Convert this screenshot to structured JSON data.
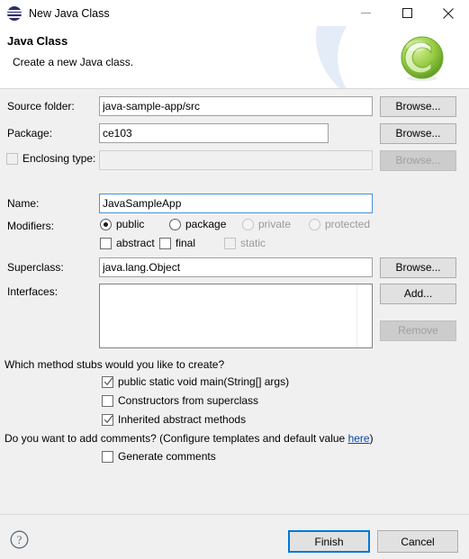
{
  "window": {
    "title": "New Java Class",
    "icon": "eclipse-sphere-icon",
    "minimize_label": "—",
    "maximize_label": "☐",
    "close_label": "✕"
  },
  "header": {
    "title": "Java Class",
    "subtitle": "Create a new Java class.",
    "logo": "eclipse-green-c-logo"
  },
  "fields": {
    "source_folder": {
      "label": "Source folder:",
      "value": "java-sample-app/src",
      "browse_label": "Browse..."
    },
    "package": {
      "label": "Package:",
      "value": "ce103",
      "browse_label": "Browse..."
    },
    "enclosing_type": {
      "label": "Enclosing type:",
      "value": "",
      "checked": false,
      "enabled": false,
      "browse_label": "Browse..."
    },
    "name": {
      "label": "Name:",
      "value": "JavaSampleApp",
      "focused": true
    },
    "superclass": {
      "label": "Superclass:",
      "value": "java.lang.Object",
      "browse_label": "Browse..."
    },
    "interfaces": {
      "label": "Interfaces:",
      "items": [],
      "add_label": "Add...",
      "remove_label": "Remove"
    }
  },
  "modifiers": {
    "label": "Modifiers:",
    "radios": [
      {
        "label": "public",
        "selected": true,
        "enabled": true
      },
      {
        "label": "package",
        "selected": false,
        "enabled": true
      },
      {
        "label": "private",
        "selected": false,
        "enabled": false
      },
      {
        "label": "protected",
        "selected": false,
        "enabled": false
      }
    ],
    "checkboxes": [
      {
        "label": "abstract",
        "checked": false,
        "enabled": true
      },
      {
        "label": "final",
        "checked": false,
        "enabled": true
      },
      {
        "label": "static",
        "checked": false,
        "enabled": false
      }
    ]
  },
  "stubs": {
    "question": "Which method stubs would you like to create?",
    "options": [
      {
        "label": "public static void main(String[] args)",
        "checked": true
      },
      {
        "label": "Constructors from superclass",
        "checked": false
      },
      {
        "label": "Inherited abstract methods",
        "checked": true
      }
    ]
  },
  "comments": {
    "question_prefix": "Do you want to add comments? (Configure templates and default value ",
    "link_label": "here",
    "question_suffix": ")",
    "option": {
      "label": "Generate comments",
      "checked": false
    }
  },
  "footer": {
    "help_label": "?",
    "finish_label": "Finish",
    "cancel_label": "Cancel"
  },
  "colors": {
    "accent": "#0078d7",
    "link": "#0645ad",
    "dialog_bg": "#f0f0f0",
    "banner_bg": "#ffffff",
    "logo_green": "#8cc63e"
  }
}
